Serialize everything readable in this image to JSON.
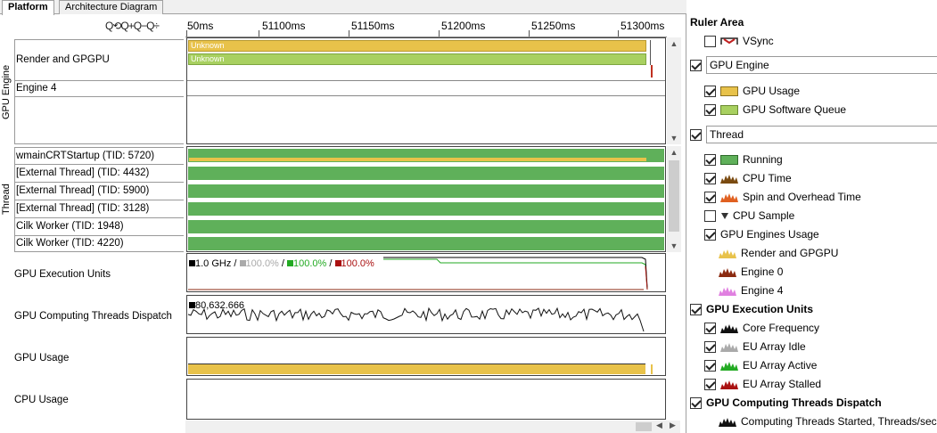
{
  "tabs": [
    "Platform",
    "Architecture Diagram"
  ],
  "zoom_tools": "Q⟲Q+Q−Q÷",
  "ruler": {
    "ticks": [
      "50ms",
      "51100ms",
      "51150ms",
      "51200ms",
      "51250ms",
      "51300ms"
    ]
  },
  "groups": {
    "gpu_engine": "GPU Engine",
    "thread": "Thread"
  },
  "gpu_rows": {
    "render": "Render and GPGPU",
    "engine4": "Engine 4",
    "bar1": "Unknown",
    "bar2": "Unknown"
  },
  "threads": [
    "wmainCRTStartup (TID: 5720)",
    "[External Thread] (TID: 4432)",
    "[External Thread] (TID: 5900)",
    "[External Thread] (TID: 3128)",
    "Cilk Worker (TID: 1948)",
    "Cilk Worker (TID: 4220)"
  ],
  "sections": {
    "eu": "GPU Execution Units",
    "dispatch": "GPU Computing Threads Dispatch",
    "usage": "GPU Usage",
    "cpu": "CPU Usage"
  },
  "eu_legend": {
    "freq": "1.0 GHz",
    "idle": "100.0%",
    "active": "100.0%",
    "stalled": "100.0%",
    "sep": " / "
  },
  "dispatch_value": "80,632.666",
  "panel": {
    "title": "Ruler Area",
    "vsync": "VSync",
    "gpu_engine_select": "GPU Engine",
    "gpu_usage": "GPU Usage",
    "gpu_sw_queue": "GPU Software Queue",
    "thread_select": "Thread",
    "running": "Running",
    "cpu_time": "CPU Time",
    "spin": "Spin and Overhead Time",
    "cpu_sample": "CPU Sample",
    "gpu_engines_usage": "GPU Engines Usage",
    "render": "Render and GPGPU",
    "engine0": "Engine 0",
    "engine4": "Engine 4",
    "eu_title": "GPU Execution Units",
    "core_freq": "Core Frequency",
    "eu_idle": "EU Array Idle",
    "eu_active": "EU Array Active",
    "eu_stalled": "EU Array Stalled",
    "dispatch_title": "GPU Computing Threads Dispatch",
    "dispatch_started": "Computing Threads Started, Threads/sec"
  },
  "colors": {
    "gpu_usage": "#e8c24a",
    "gpu_queue": "#a8d060",
    "running": "#5fb05a",
    "cpu_time": "#7a4a10",
    "spin": "#e06020",
    "render": "#e8c24a",
    "engine0": "#8b2a10",
    "engine4": "#e080e0",
    "eu_idle": "#aaaaaa",
    "eu_active": "#22aa22",
    "eu_stalled": "#aa1111"
  }
}
